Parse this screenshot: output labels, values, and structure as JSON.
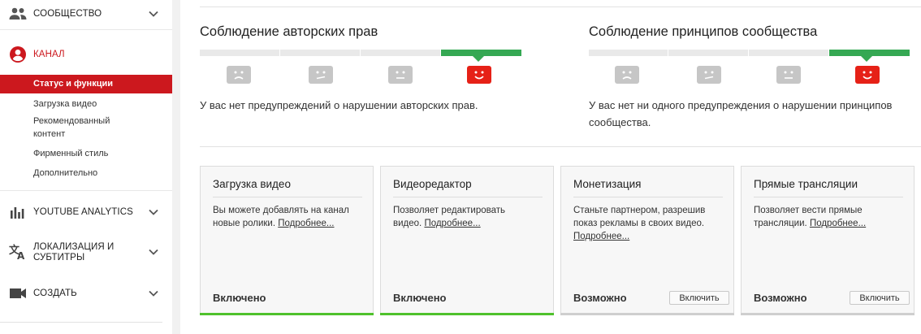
{
  "sidebar": {
    "community": {
      "label": "СООБЩЕСТВО",
      "icon": "people-icon"
    },
    "channel": {
      "label": "КАНАЛ",
      "icon": "account-circle-icon",
      "accent": "#cc181e",
      "items": [
        "Статус и функции",
        "Загрузка видео",
        "Рекомендованный",
        "контент",
        "Фирменный стиль",
        "Дополнительно"
      ]
    },
    "analytics": {
      "label": "YOUTUBE ANALYTICS",
      "icon": "bar-chart-icon"
    },
    "localization": {
      "label_line1": "ЛОКАЛИЗАЦИЯ И",
      "label_line2": "СУБТИТРЫ",
      "icon": "translate-icon"
    },
    "create": {
      "label": "СОЗДАТЬ",
      "icon": "video-camera-icon"
    }
  },
  "strikes": {
    "copyright": {
      "title": "Соблюдение авторских прав",
      "message": "У вас нет предупреждений о нарушении авторских прав."
    },
    "community": {
      "title": "Соблюдение принципов сообщества",
      "message_line1": "У вас нет ни одного предупреждения о нарушении принципов",
      "message_line2": "сообщества."
    },
    "colors": {
      "good": "#35a853",
      "face_active": "#e62117",
      "face_inactive": "#c6c6c6"
    }
  },
  "features": [
    {
      "title": "Загрузка видео",
      "desc_line1": "Вы можете добавлять на канал",
      "desc_line2": "новые ролики.",
      "link": "Подробнее...",
      "status": "Включено",
      "button": ""
    },
    {
      "title": "Видеоредактор",
      "desc_line1": "Позволяет редактировать",
      "desc_line2": "видео.",
      "link": "Подробнее...",
      "status": "Включено",
      "button": ""
    },
    {
      "title": "Монетизация",
      "desc_line1": "Станьте партнером, разрешив",
      "desc_line2": "показ рекламы в своих видео.",
      "link": "Подробнее...",
      "status": "Возможно",
      "button": "Включить"
    },
    {
      "title": "Прямые трансляции",
      "desc_line1": "Позволяет вести прямые",
      "desc_line2": "трансляции.",
      "link": "Подробнее...",
      "status": "Возможно",
      "button": "Включить"
    }
  ]
}
